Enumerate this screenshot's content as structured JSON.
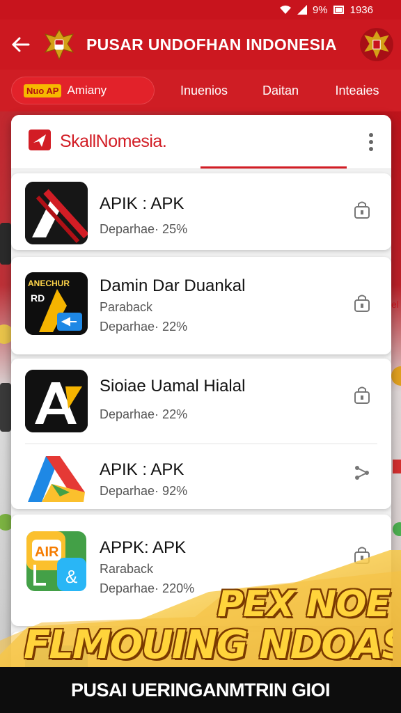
{
  "status_bar": {
    "battery_text": "9%",
    "time": "1936",
    "icons": [
      "wifi-icon",
      "signal-icon",
      "battery-icon"
    ]
  },
  "app_bar": {
    "title": "PUSAR UNDOFHAN INDONESIA"
  },
  "tabs": {
    "active": {
      "tag": "Nuo AP",
      "label": "Amiany"
    },
    "items": [
      "Inuenios",
      "Daitan",
      "Inteaies"
    ]
  },
  "panel": {
    "brand": "SkallNomesia."
  },
  "apps": [
    {
      "name": "APIK : APK",
      "sub": "",
      "meta": "Deparhae· 25%",
      "icon": "app-icon-red-black",
      "action": "lock-icon"
    },
    {
      "name": "Damin Dar Duankal",
      "sub": "Paraback",
      "meta": "Deparhae· 22%",
      "icon": "app-icon-arrow-yellow",
      "icon_text_top": "ANECHUR",
      "icon_text_mid": "RD",
      "action": "lock-icon"
    },
    {
      "name": "Sioiae Uamal Hialal",
      "sub": "",
      "meta": "Deparhae· 22%",
      "icon": "app-icon-a-black",
      "action": "lock-icon"
    },
    {
      "name": "APIK : APK",
      "sub": "",
      "meta": "Deparhae· 92%",
      "icon": "app-icon-triangle-colorful",
      "action": "share-icon"
    },
    {
      "name": "APPK: APK",
      "sub": "Raraback",
      "meta": "Deparhae· 220%",
      "icon": "app-icon-air-colorful",
      "icon_text_top": "AIR",
      "icon_text_mid": "&",
      "action": "lock-icon"
    }
  ],
  "banner": {
    "line1": "PEX NOE",
    "line2": "FLMOUING NDOAS!"
  },
  "footer": {
    "text": "PUSAI UERINGANMTRIN GIOI"
  },
  "colors": {
    "primary": "#cc1820",
    "accent": "#f7b800",
    "banner_text": "#ffd43b"
  }
}
